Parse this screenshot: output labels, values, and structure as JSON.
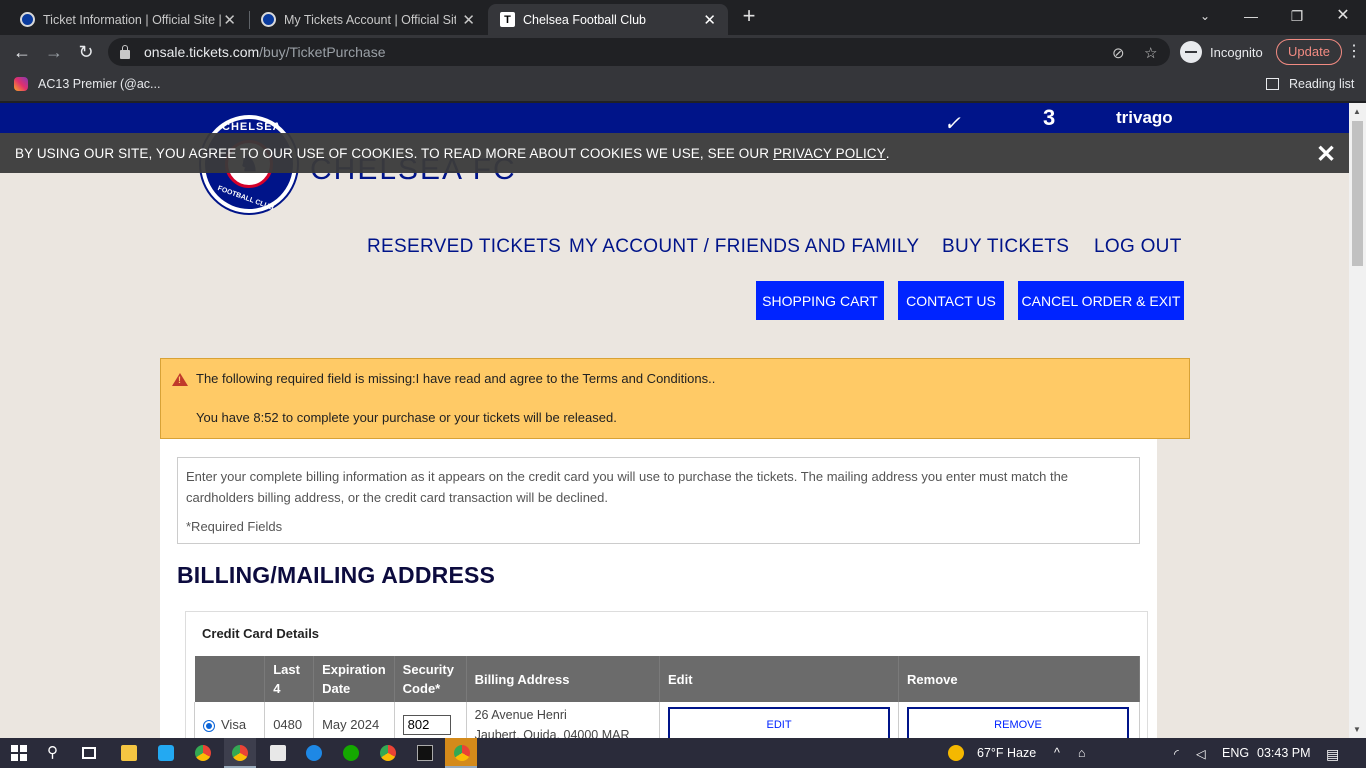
{
  "browser": {
    "tabs": [
      {
        "title": "Ticket Information | Official Site |",
        "active": false
      },
      {
        "title": "My Tickets Account | Official Site",
        "active": false
      },
      {
        "title": "Chelsea Football Club",
        "active": true
      }
    ],
    "active_tab_favicon": "T",
    "url_host": "onsale.tickets.com",
    "url_path": "/buy/TicketPurchase",
    "incognito_label": "Incognito",
    "update_label": "Update",
    "bookmark_label": "AC13 Premier (@ac...",
    "reading_list_label": "Reading list"
  },
  "sponsors": {
    "nike": "✓",
    "three": "3",
    "trivago": "trivago"
  },
  "club": {
    "crest_top": "CHELSEA",
    "crest_bottom": "FOOTBALL CLUB",
    "name": "CHELSEA FC"
  },
  "cookie_banner": {
    "text": "BY USING OUR SITE, YOU AGREE TO OUR USE OF COOKIES. TO READ MORE ABOUT COOKIES WE USE, SEE OUR",
    "link": "PRIVACY POLICY",
    "suffix": ".",
    "close": "✕"
  },
  "nav": {
    "reserved": "RESERVED TICKETS",
    "account": "MY ACCOUNT / FRIENDS AND FAMILY",
    "buy": "BUY TICKETS",
    "logout": "LOG OUT"
  },
  "actions": {
    "cart": "SHOPPING CART",
    "contact": "CONTACT US",
    "cancel": "CANCEL ORDER & EXIT"
  },
  "alert": {
    "missing": "The following required field is missing:I have read and agree to the Terms and Conditions..",
    "timer": "You have 8:52 to complete your purchase or your tickets will be released."
  },
  "info": {
    "text": "Enter your complete billing information as it appears on the credit card you will use to purchase the tickets. The mailing address you enter must match the cardholders billing address, or the credit card transaction will be declined.",
    "required": "*Required Fields"
  },
  "billing_title": "BILLING/MAILING ADDRESS",
  "credit_card": {
    "title": "Credit Card Details",
    "headers": {
      "last4_a": "Last",
      "last4_b": "4",
      "exp_a": "Expiration",
      "exp_b": "Date",
      "sec_a": "Security",
      "sec_b": "Code*",
      "billing": "Billing Address",
      "edit": "Edit",
      "remove": "Remove"
    },
    "row": {
      "type": "Visa",
      "last4": "0480",
      "expiration": "May 2024",
      "security_code": "802",
      "address_line1": "26 Avenue Henri",
      "address_line2": "Jaubert, Ouida, 04000 MAR",
      "edit": "EDIT",
      "remove": "REMOVE"
    }
  },
  "taskbar": {
    "weather": "67°F  Haze",
    "lang": "ENG",
    "time": "03:43 PM"
  }
}
